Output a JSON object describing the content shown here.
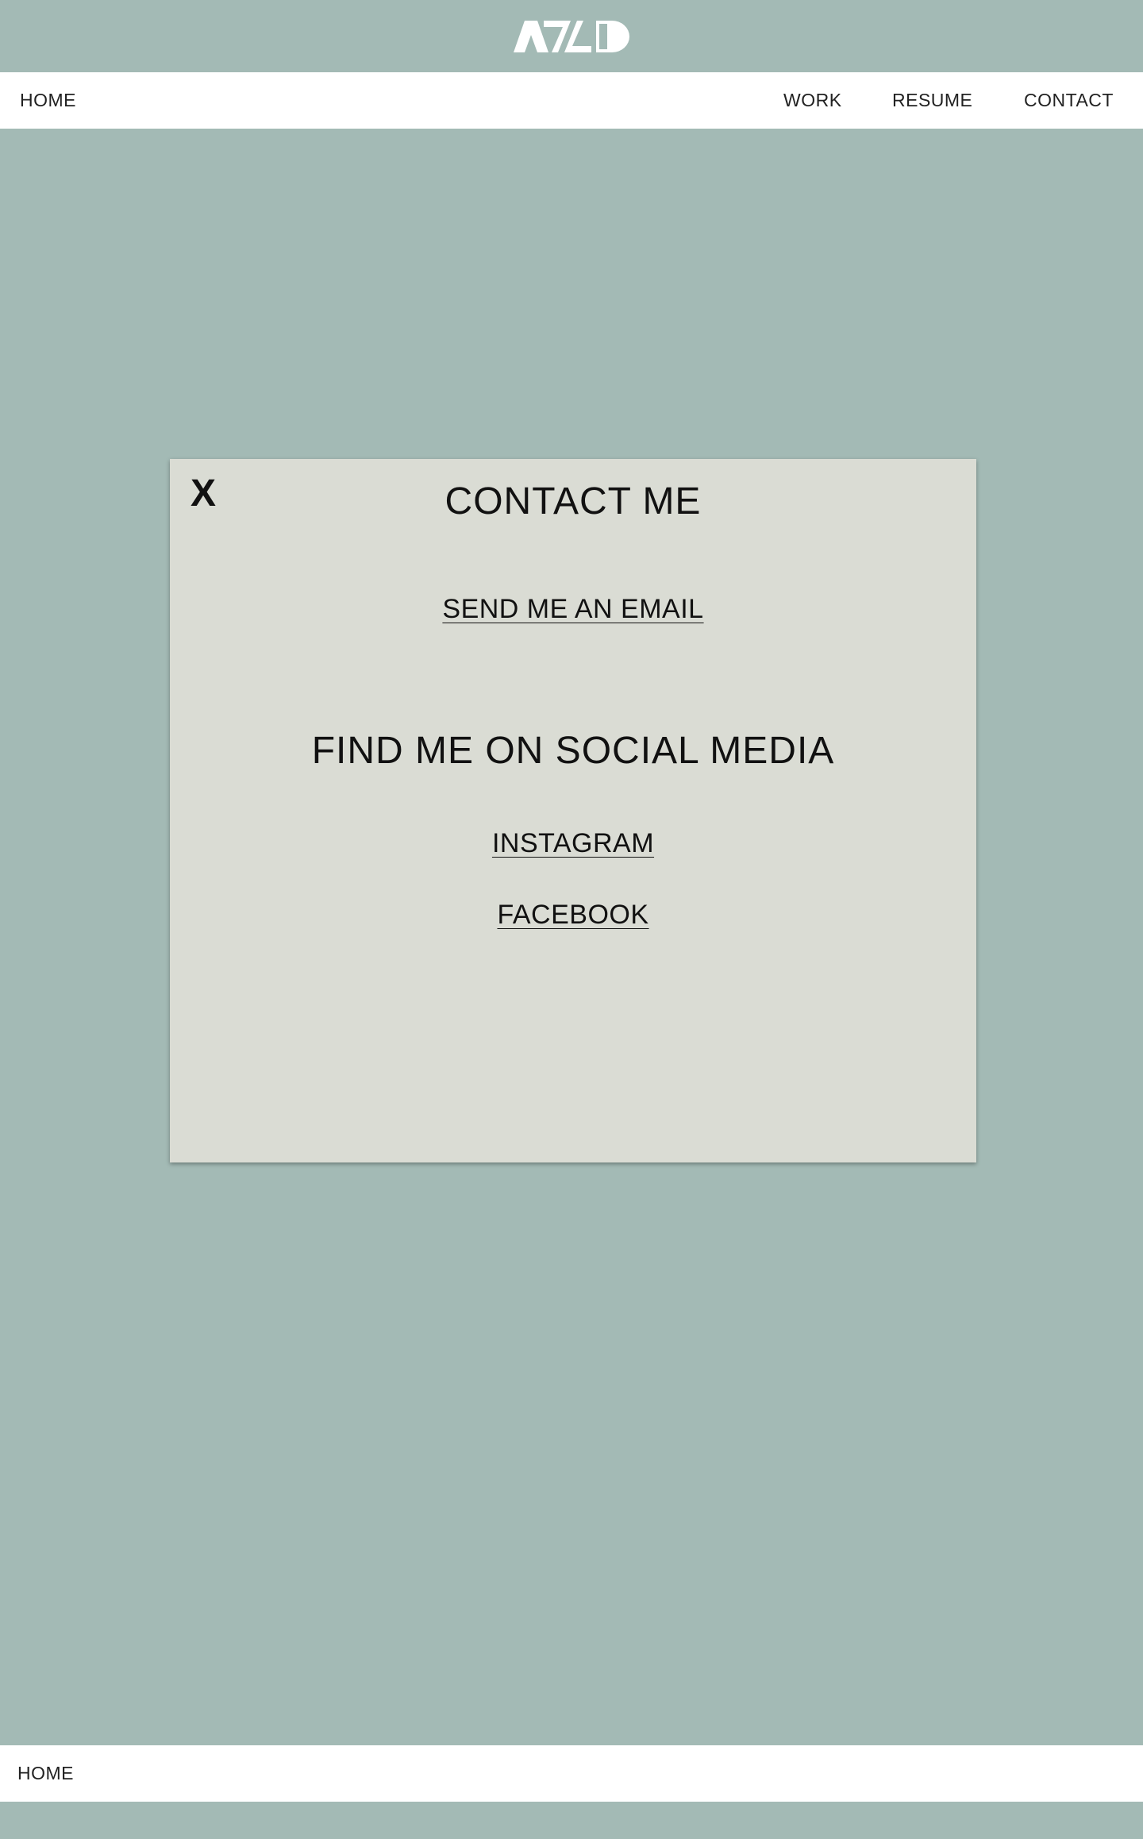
{
  "logo": {
    "icon": "azd-logo",
    "color": "#ffffff"
  },
  "topnav": {
    "home": "HOME",
    "work": "WORK",
    "resume": "RESUME",
    "contact": "CONTACT"
  },
  "modal": {
    "close": "X",
    "title": "CONTACT ME",
    "email_link": "SEND ME AN EMAIL",
    "social_heading": "FIND ME ON SOCIAL MEDIA",
    "instagram": "INSTAGRAM",
    "facebook": "FACEBOOK"
  },
  "bottomnav": {
    "home": "HOME"
  },
  "colors": {
    "page_background": "#a3bab5",
    "nav_background": "#ffffff",
    "modal_background": "#dadcd4",
    "text": "#111111"
  }
}
